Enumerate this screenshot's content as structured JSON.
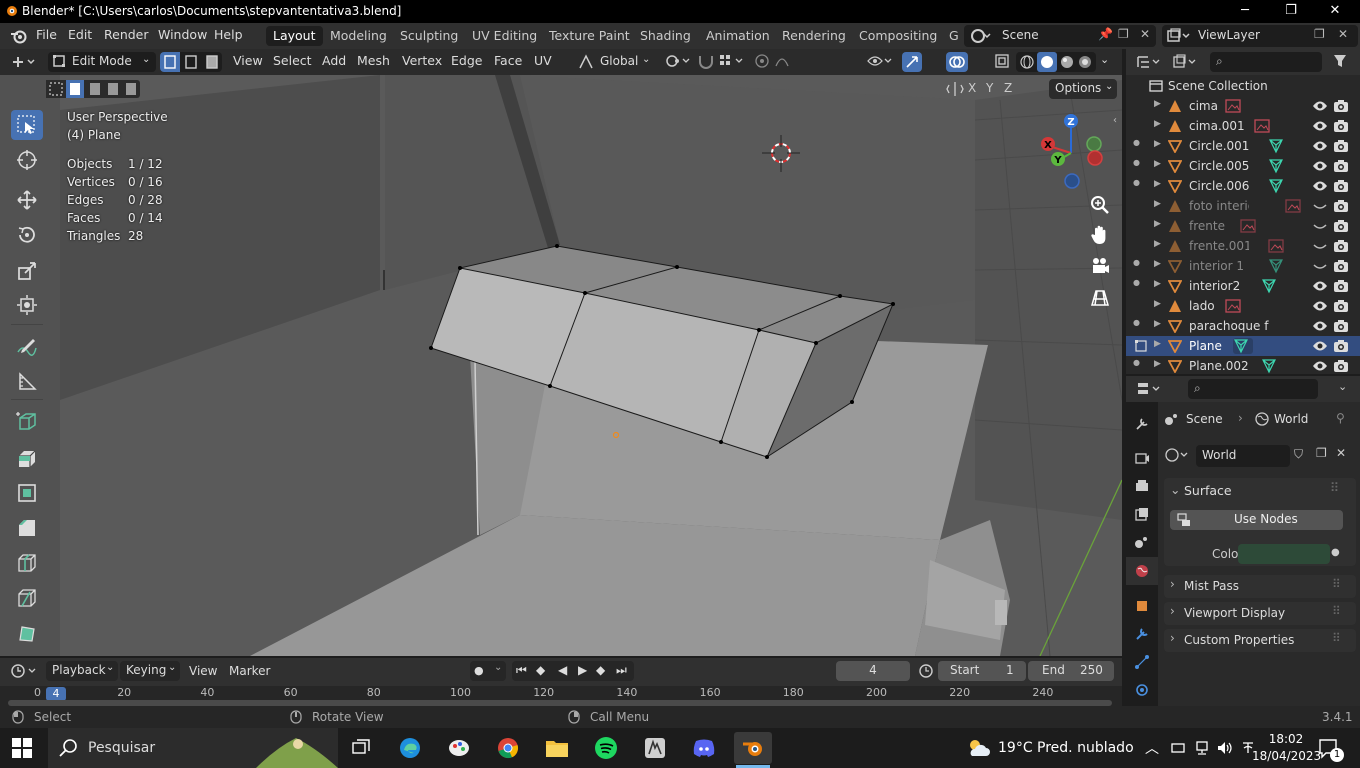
{
  "window": {
    "title": "Blender* [C:\\Users\\carlos\\Documents\\stepvantentativa3.blend]",
    "minimize": "─",
    "maximize": "❐",
    "close": "✕"
  },
  "menubar": {
    "items": [
      "File",
      "Edit",
      "Render",
      "Window",
      "Help"
    ],
    "workspaces": [
      "Layout",
      "Modeling",
      "Sculpting",
      "UV Editing",
      "Texture Paint",
      "Shading",
      "Animation",
      "Rendering",
      "Compositing",
      "G"
    ],
    "scene": "Scene",
    "view_layer": "ViewLayer"
  },
  "header3d": {
    "mode": "Edit Mode",
    "menus": [
      "View",
      "Select",
      "Add",
      "Mesh",
      "Vertex",
      "Edge",
      "Face",
      "UV"
    ],
    "orientation": "Global",
    "axes": [
      "X",
      "Y",
      "Z"
    ],
    "options": "Options"
  },
  "overlay": {
    "view_name": "User Perspective",
    "object_name": "(4) Plane",
    "stats": [
      {
        "label": "Objects",
        "value": "1 / 12"
      },
      {
        "label": "Vertices",
        "value": "0 / 16"
      },
      {
        "label": "Edges",
        "value": "0 / 28"
      },
      {
        "label": "Faces",
        "value": "0 / 14"
      },
      {
        "label": "Triangles",
        "value": "28"
      }
    ]
  },
  "gizmo": {
    "x": "X",
    "y": "Y",
    "z": "Z"
  },
  "outliner": {
    "search_placeholder": "",
    "collection": "Scene Collection",
    "items": [
      {
        "name": "cima",
        "type": "image",
        "visible": true
      },
      {
        "name": "cima.001",
        "type": "image",
        "visible": true
      },
      {
        "name": "Circle.001",
        "type": "mesh",
        "visible": true
      },
      {
        "name": "Circle.005",
        "type": "mesh",
        "visible": true
      },
      {
        "name": "Circle.006",
        "type": "mesh",
        "visible": true
      },
      {
        "name": "foto interior",
        "type": "image",
        "visible": false
      },
      {
        "name": "frente",
        "type": "image",
        "visible": false
      },
      {
        "name": "frente.001",
        "type": "image",
        "visible": false
      },
      {
        "name": "interior 1",
        "type": "mesh",
        "visible": false
      },
      {
        "name": "interior2",
        "type": "mesh",
        "visible": true
      },
      {
        "name": "lado",
        "type": "image",
        "visible": true
      },
      {
        "name": "parachoque frente",
        "type": "mesh",
        "visible": true
      },
      {
        "name": "Plane",
        "type": "mesh",
        "visible": true,
        "selected": true
      },
      {
        "name": "Plane.002",
        "type": "mesh",
        "visible": true
      }
    ]
  },
  "properties": {
    "breadcrumb_scene": "Scene",
    "breadcrumb_world": "World",
    "world_name": "World",
    "sections": {
      "surface": "Surface",
      "use_nodes": "Use Nodes",
      "color_label": "Color",
      "mist": "Mist Pass",
      "viewport": "Viewport Display",
      "custom": "Custom Properties"
    },
    "color_value": "#2d4a38"
  },
  "timeline": {
    "menus": [
      "Playback",
      "Keying",
      "View",
      "Marker"
    ],
    "current_frame": "4",
    "start_label": "Start",
    "start": "1",
    "end_label": "End",
    "end": "250",
    "ticks": [
      "0",
      "20",
      "40",
      "60",
      "80",
      "100",
      "120",
      "140",
      "160",
      "180",
      "200",
      "220",
      "240"
    ],
    "cursor": "4"
  },
  "statusbar": {
    "select": "Select",
    "rotate": "Rotate View",
    "menu": "Call Menu",
    "version": "3.4.1"
  },
  "taskbar": {
    "search": "Pesquisar",
    "weather": "19°C  Pred. nublado",
    "time": "18:02",
    "date": "18/04/2023",
    "notif": "1"
  },
  "colors": {
    "accent": "#4772b3",
    "selected_row": "#334d80",
    "object_orange": "#e08a3c",
    "mesh_green": "#3dd6b0"
  }
}
